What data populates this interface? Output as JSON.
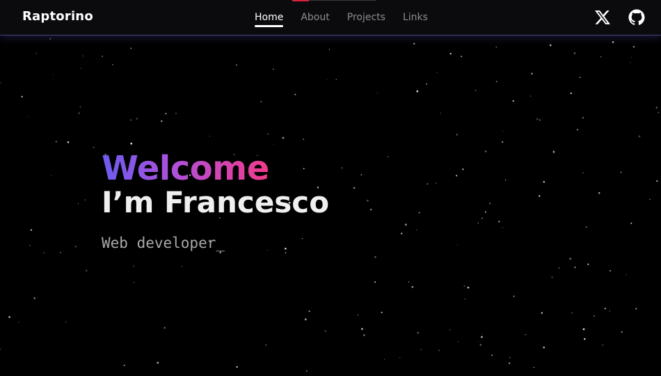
{
  "navbar": {
    "brand": "Raptorino",
    "links": [
      {
        "label": "Home",
        "active": true
      },
      {
        "label": "About",
        "active": false
      },
      {
        "label": "Projects",
        "active": false
      },
      {
        "label": "Links",
        "active": false
      }
    ],
    "icons": [
      "x-twitter-icon",
      "github-icon"
    ]
  },
  "hero": {
    "greeting": "Welcome",
    "headline": "I’m Francesco",
    "role": "Web developer_"
  },
  "colors": {
    "background": "#000000",
    "nav_background": "#0b0b0e",
    "gradient_start": "#6b5cf0",
    "gradient_mid": "#b24fd9",
    "gradient_end": "#f23a8a",
    "headline": "#efefef",
    "role_text": "#a9a9a9",
    "nav_inactive": "#8d8d8d"
  }
}
